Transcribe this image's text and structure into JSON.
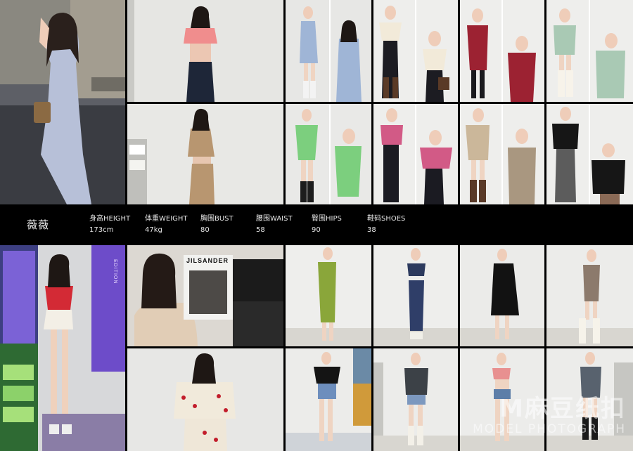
{
  "model": {
    "name": "薇薇",
    "stats": [
      {
        "label": "身高HEIGHT",
        "value": "173cm"
      },
      {
        "label": "体重WEIGHT",
        "value": "47kg"
      },
      {
        "label": "胸围BUST",
        "value": "80"
      },
      {
        "label": "腰围WAIST",
        "value": "58"
      },
      {
        "label": "臀围HIPS",
        "value": "90"
      },
      {
        "label": "鞋码SHOES",
        "value": "38"
      }
    ]
  },
  "poster_text": "JILSANDER",
  "side_sign": "EDITION",
  "watermark": {
    "main": "M麻豆纸扣",
    "sub": "MODEL PHOTOGRAPH"
  }
}
